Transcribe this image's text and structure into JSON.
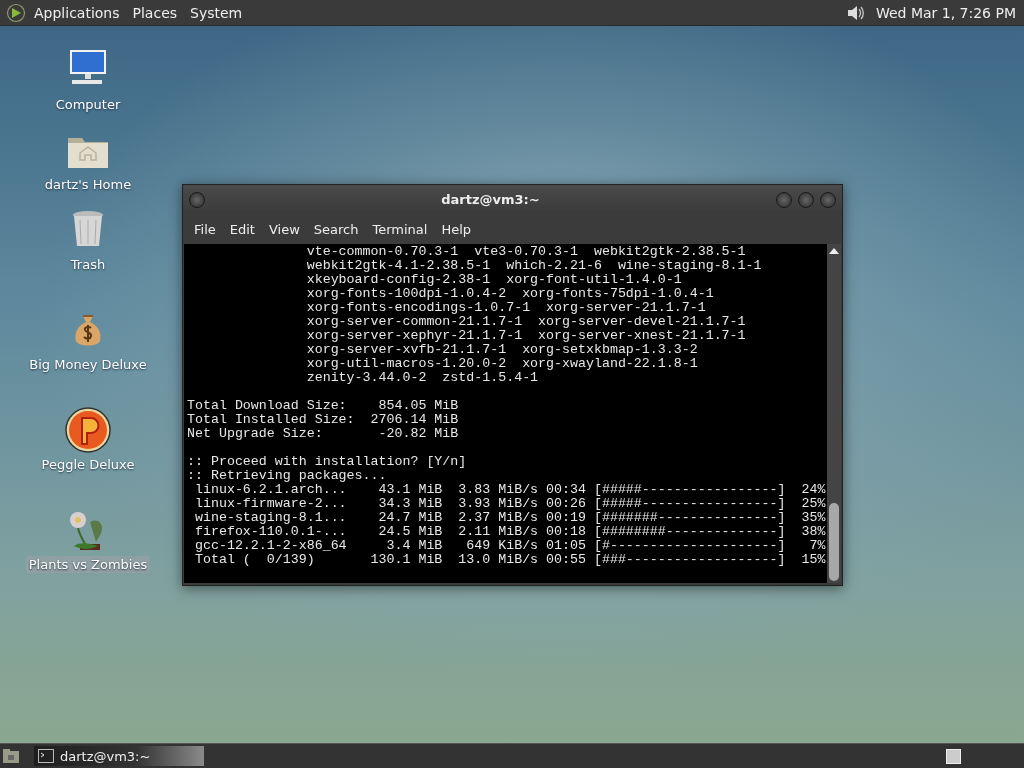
{
  "top_panel": {
    "menus": [
      "Applications",
      "Places",
      "System"
    ],
    "clock": "Wed Mar 1, 7:26 PM"
  },
  "desktop_icons": [
    {
      "label": "Computer",
      "kind": "computer",
      "selected": false
    },
    {
      "label": "dartz's Home",
      "kind": "home",
      "selected": false
    },
    {
      "label": "Trash",
      "kind": "trash",
      "selected": false
    },
    {
      "label": "Big Money Deluxe",
      "kind": "money",
      "selected": false
    },
    {
      "label": "Peggle Deluxe",
      "kind": "peggle",
      "selected": false
    },
    {
      "label": "Plants vs Zombies",
      "kind": "plants",
      "selected": true
    }
  ],
  "terminal_window": {
    "title": "dartz@vm3:~",
    "menus": [
      "File",
      "Edit",
      "View",
      "Search",
      "Terminal",
      "Help"
    ],
    "output_blocks": [
      [
        "               vte-common-0.70.3-1  vte3-0.70.3-1  webkit2gtk-2.38.5-1",
        "               webkit2gtk-4.1-2.38.5-1  which-2.21-6  wine-staging-8.1-1",
        "               xkeyboard-config-2.38-1  xorg-font-util-1.4.0-1",
        "               xorg-fonts-100dpi-1.0.4-2  xorg-fonts-75dpi-1.0.4-1",
        "               xorg-fonts-encodings-1.0.7-1  xorg-server-21.1.7-1",
        "               xorg-server-common-21.1.7-1  xorg-server-devel-21.1.7-1",
        "               xorg-server-xephyr-21.1.7-1  xorg-server-xnest-21.1.7-1",
        "               xorg-server-xvfb-21.1.7-1  xorg-setxkbmap-1.3.3-2",
        "               xorg-util-macros-1.20.0-2  xorg-xwayland-22.1.8-1",
        "               zenity-3.44.0-2  zstd-1.5.4-1"
      ],
      [
        "Total Download Size:    854.05 MiB",
        "Total Installed Size:  2706.14 MiB",
        "Net Upgrade Size:       -20.82 MiB"
      ],
      [
        ":: Proceed with installation? [Y/n]",
        ":: Retrieving packages...",
        " linux-6.2.1.arch...    43.1 MiB  3.83 MiB/s 00:34 [#####-----------------]  24%",
        " linux-firmware-2...    34.3 MiB  3.93 MiB/s 00:26 [#####-----------------]  25%",
        " wine-staging-8.1...    24.7 MiB  2.37 MiB/s 00:19 [#######---------------]  35%",
        " firefox-110.0.1-...    24.5 MiB  2.11 MiB/s 00:18 [########--------------]  38%",
        " gcc-12.2.1-2-x86_64     3.4 MiB   649 KiB/s 01:05 [#---------------------]   7%",
        " Total (  0/139)       130.1 MiB  13.0 MiB/s 00:55 [###-------------------]  15%"
      ]
    ]
  },
  "taskbar": {
    "tasks": [
      {
        "label": "dartz@vm3:~",
        "selected": true
      }
    ]
  }
}
